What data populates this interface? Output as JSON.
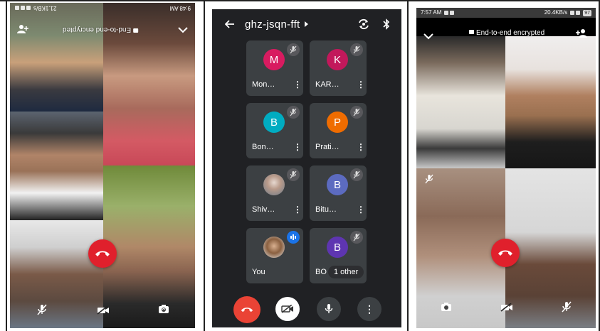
{
  "left_screen": {
    "status": {
      "time": "9:48 AM",
      "speed": "21.1KB/s"
    },
    "encryption_label": "End-to-end encrypted",
    "icons": {
      "add_person": "add-person-icon",
      "collapse": "chevron-down-icon",
      "mic_off": "mic-off-icon",
      "video_off": "video-off-icon",
      "switch_camera": "switch-camera-icon",
      "end_call": "end-call-icon"
    }
  },
  "middle_screen": {
    "meeting_code": "ghz-jsqn-fft",
    "participants": [
      {
        "initial": "M",
        "name": "Mon…",
        "color": "#d81b60",
        "muted": true
      },
      {
        "initial": "K",
        "name": "KAR…",
        "color": "#c2185b",
        "muted": true
      },
      {
        "initial": "B",
        "name": "Bon…",
        "color": "#00acc1",
        "muted": true
      },
      {
        "initial": "P",
        "name": "Prati…",
        "color": "#ef6c00",
        "muted": true
      },
      {
        "initial": "",
        "name": "Shiv…",
        "color": "#9e9e9e",
        "muted": true
      },
      {
        "initial": "B",
        "name": "Bitu…",
        "color": "#5c6bc0",
        "muted": true
      },
      {
        "initial": "",
        "name": "You",
        "color": "#9e9e9e",
        "muted": false
      },
      {
        "initial": "B",
        "name": "BO",
        "color": "#5e35b1",
        "muted": true
      }
    ],
    "others_label": "1 other",
    "colors": {
      "background": "#202124",
      "card": "#3c4043",
      "end_call": "#ea4335",
      "speaking": "#1a73e8"
    }
  },
  "right_screen": {
    "status": {
      "time": "7:57 AM",
      "speed": "20.4KB/s",
      "battery": "97"
    },
    "encryption_label": "End-to-end encrypted"
  }
}
